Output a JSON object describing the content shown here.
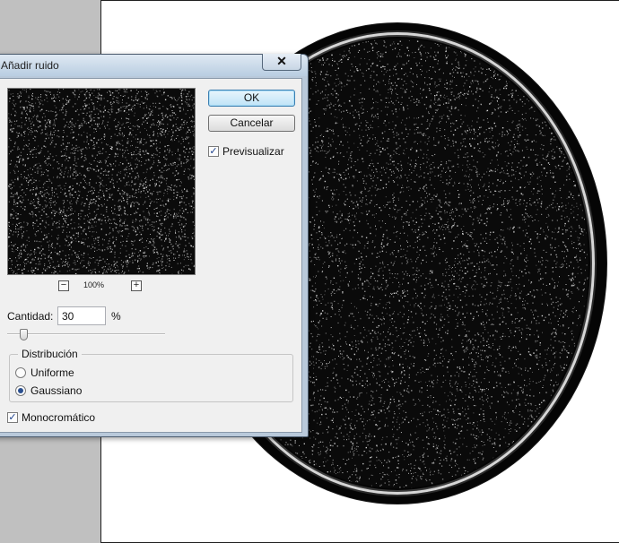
{
  "dialog": {
    "title": "Añadir ruido",
    "close_glyph": "✕",
    "ok_label": "OK",
    "cancel_label": "Cancelar",
    "preview_label": "Previsualizar",
    "preview_checked": true,
    "zoom": {
      "out_glyph": "−",
      "in_glyph": "+",
      "level": "100%"
    },
    "amount": {
      "label": "Cantidad:",
      "value": "30",
      "unit": "%",
      "slider_fraction": 0.075
    },
    "distribution": {
      "legend": "Distribución",
      "options": [
        {
          "label": "Uniforme",
          "selected": false
        },
        {
          "label": "Gaussiano",
          "selected": true
        }
      ]
    },
    "monochrome": {
      "label": "Monocromático",
      "checked": true
    },
    "check_glyph": "✓"
  },
  "colors": {
    "noise_dot": "#d8d8d8",
    "plate_black": "#050505",
    "default_button_border": "#3c7fb1"
  },
  "icons": {
    "close": "close-icon",
    "zoom_out": "minus-icon",
    "zoom_in": "plus-icon",
    "checkmark": "checkmark-icon"
  }
}
